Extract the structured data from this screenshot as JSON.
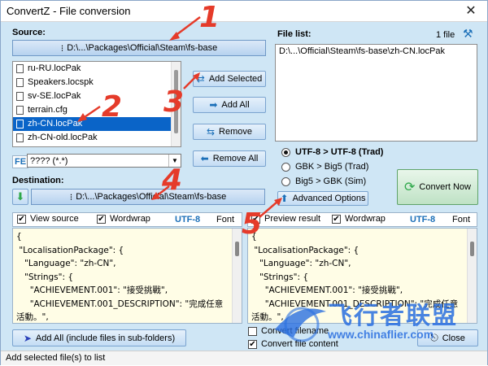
{
  "window": {
    "title": "ConvertZ - File conversion"
  },
  "source": {
    "label": "Source:",
    "path": "D:\\...\\Packages\\Official\\Steam\\fs-base",
    "files": [
      {
        "name": "ru-RU.locPak",
        "selected": false
      },
      {
        "name": "Speakers.locspk",
        "selected": false
      },
      {
        "name": "sv-SE.locPak",
        "selected": false
      },
      {
        "name": "terrain.cfg",
        "selected": false
      },
      {
        "name": "zh-CN.locPak",
        "selected": true
      },
      {
        "name": "zh-CN-old.locPak",
        "selected": false
      }
    ],
    "filter_label": "FE",
    "filter_value": "???? (*.*)"
  },
  "actions": {
    "add_selected": "Add Selected",
    "add_all": "Add All",
    "remove": "Remove",
    "remove_all": "Remove All"
  },
  "filelist": {
    "label": "File list:",
    "count": "1 file",
    "items": [
      "D:\\...\\Official\\Steam\\fs-base\\zh-CN.locPak"
    ]
  },
  "conversion": {
    "options": [
      {
        "label": "UTF-8 > UTF-8 (Trad)",
        "selected": true
      },
      {
        "label": "GBK > Big5 (Trad)",
        "selected": false
      },
      {
        "label": "Big5 > GBK (Sim)",
        "selected": false
      }
    ],
    "convert_now": "Convert Now",
    "advanced": "Advanced Options"
  },
  "destination": {
    "label": "Destination:",
    "path": "D:\\...\\Packages\\Official\\Steam\\fs-base"
  },
  "source_pane": {
    "view_label": "View source",
    "wordwrap_label": "Wordwrap",
    "encoding": "UTF-8",
    "font_label": "Font",
    "lines": "{\n \"LocalisationPackage\": {\n   \"Language\": \"zh-CN\",\n   \"Strings\": {\n     \"ACHIEVEMENT.001\": \"接受挑戰\",\n     \"ACHIEVEMENT.001_DESCRIPTION\": \"完成任意\n活動。\","
  },
  "preview_pane": {
    "preview_label": "Preview result",
    "wordwrap_label": "Wordwrap",
    "encoding": "UTF-8",
    "font_label": "Font",
    "lines": "{\n \"LocalisationPackage\": {\n   \"Language\": \"zh-CN\",\n   \"Strings\": {\n     \"ACHIEVEMENT.001\": \"接受挑戰\",\n     \"ACHIEVEMENT.001_DESCRIPTION\": \"完成任意\n活動。\","
  },
  "bottom": {
    "add_all_sub": "Add All (include files in sub-folders)",
    "convert_filename": "Convert filename",
    "convert_file_content": "Convert file content",
    "close": "Close"
  },
  "status": "Add selected file(s) to list",
  "annotations": [
    "1",
    "2",
    "3",
    "4",
    "5"
  ],
  "watermark": {
    "text": "飞行者联盟",
    "url": "www.chinaflier.com"
  },
  "colors": {
    "accent": "#1b6fb8",
    "annotation": "#e53b2a",
    "selection": "#0a64c8",
    "convert_green": "#2ea84a"
  }
}
